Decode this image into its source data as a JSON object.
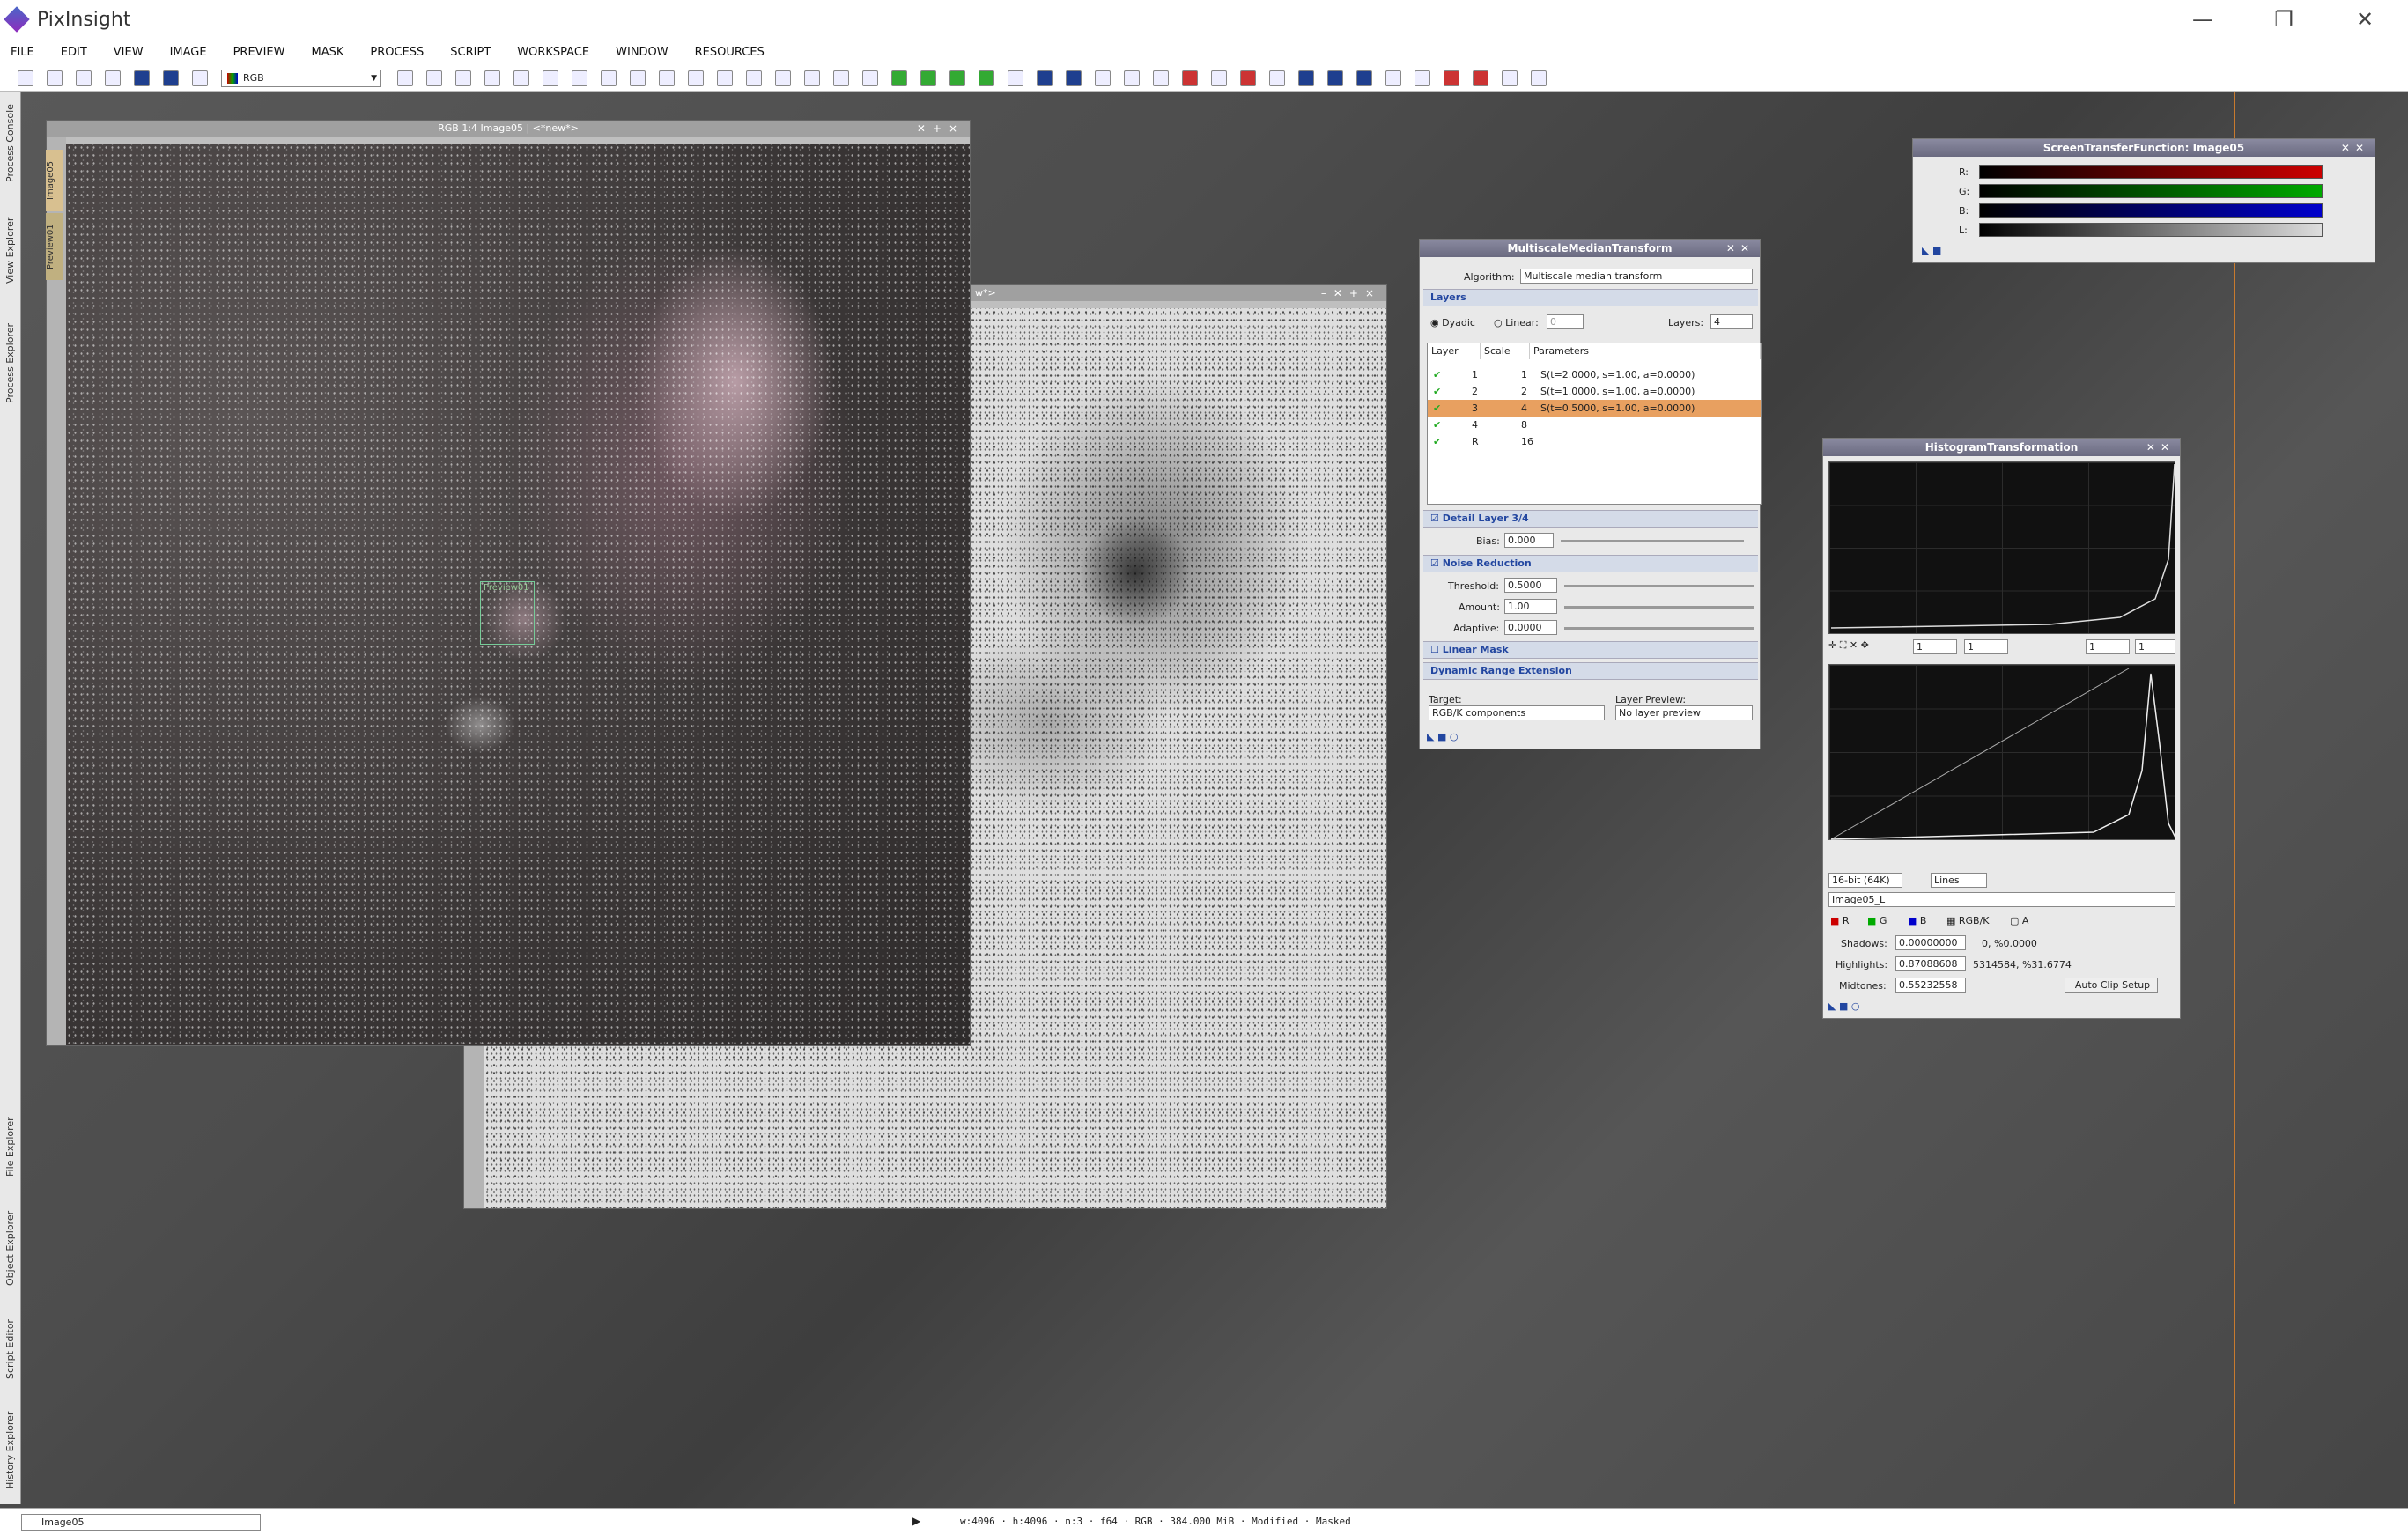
{
  "app": {
    "title": "PixInsight"
  },
  "menu": [
    "FILE",
    "EDIT",
    "VIEW",
    "IMAGE",
    "PREVIEW",
    "MASK",
    "PROCESS",
    "SCRIPT",
    "WORKSPACE",
    "WINDOW",
    "RESOURCES"
  ],
  "toolbar": {
    "color_space": "RGB"
  },
  "left_dock": {
    "top": [
      "Process Console",
      "View Explorer",
      "Process Explorer"
    ],
    "bottom": [
      "File Explorer",
      "Object Explorer",
      "Script Editor",
      "History Explorer"
    ]
  },
  "windows": {
    "color": {
      "title": "RGB 1:4 Image05 | <*new*>",
      "tabs": [
        "Image05",
        "Preview01"
      ],
      "preview_label": "Preview01"
    },
    "mono": {
      "title": "w*>"
    }
  },
  "mmt": {
    "title": "MultiscaleMedianTransform",
    "algorithm_label": "Algorithm:",
    "algorithm": "Multiscale median transform",
    "layers_section": "Layers",
    "dyadic": "Dyadic",
    "linear": "Linear:",
    "linear_value": "0",
    "layers_label": "Layers:",
    "layers_value": "4",
    "columns": [
      "Layer",
      "Scale",
      "Parameters"
    ],
    "rows": [
      {
        "layer": "1",
        "scale": "1",
        "params": "S(t=2.0000, s=1.00, a=0.0000)",
        "selected": false
      },
      {
        "layer": "2",
        "scale": "2",
        "params": "S(t=1.0000, s=1.00, a=0.0000)",
        "selected": false
      },
      {
        "layer": "3",
        "scale": "4",
        "params": "S(t=0.5000, s=1.00, a=0.0000)",
        "selected": true
      },
      {
        "layer": "4",
        "scale": "8",
        "params": "",
        "selected": false
      },
      {
        "layer": "R",
        "scale": "16",
        "params": "",
        "selected": false
      }
    ],
    "detail_section": "Detail Layer 3/4",
    "bias_label": "Bias:",
    "bias": "0.000",
    "noise_section": "Noise Reduction",
    "threshold_label": "Threshold:",
    "threshold": "0.5000",
    "amount_label": "Amount:",
    "amount": "1.00",
    "adaptive_label": "Adaptive:",
    "adaptive": "0.0000",
    "linear_mask": "Linear Mask",
    "dre": "Dynamic Range Extension",
    "target_label": "Target:",
    "target": "RGB/K components",
    "preview_label": "Layer Preview:",
    "preview": "No layer preview"
  },
  "stf": {
    "title": "ScreenTransferFunction: Image05",
    "channels": [
      "R:",
      "G:",
      "B:",
      "L:"
    ],
    "colors": [
      "#cc0000",
      "#00aa00",
      "#0000cc",
      "#dddddd"
    ]
  },
  "ht": {
    "title": "HistogramTransformation",
    "zoom": [
      "1",
      "1",
      "1",
      "1"
    ],
    "depth": "16-bit (64K)",
    "mode": "Lines",
    "view": "Image05_L",
    "channels": [
      "R",
      "G",
      "B",
      "RGB/K",
      "A"
    ],
    "shadows_label": "Shadows:",
    "shadows": "0.00000000",
    "shadows_info": "0, %0.0000",
    "highlights_label": "Highlights:",
    "highlights": "0.87088608",
    "highlights_info": "5314584, %31.6774",
    "midtones_label": "Midtones:",
    "midtones": "0.55232558",
    "autoclip": "Auto Clip Setup"
  },
  "status": {
    "view": "Image05",
    "info": "w:4096 · h:4096 · n:3 · f64 · RGB · 384.000 MiB · Modified · Masked"
  }
}
